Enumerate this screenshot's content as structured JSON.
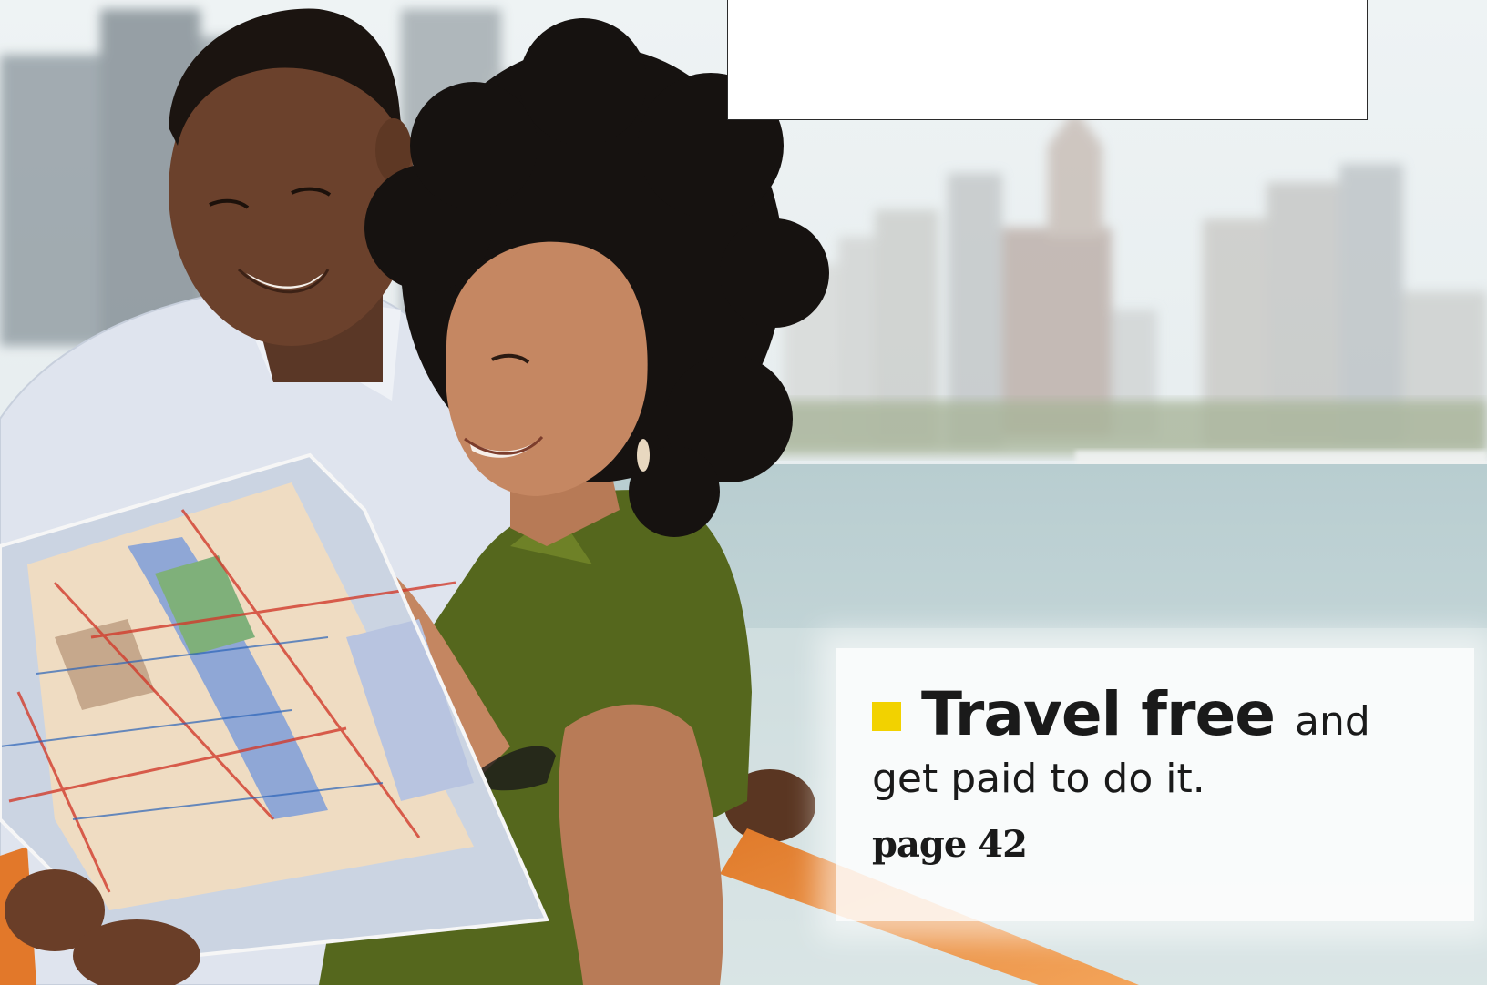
{
  "promo": {
    "headline_bold": "Travel free",
    "headline_rest": "and",
    "headline_line2": "get paid to do it.",
    "page_reference": "page 42"
  },
  "colors": {
    "bullet": "#f2d200",
    "text": "#1a1a1a"
  },
  "photo": {
    "subject": "couple-reading-city-map-on-ferry"
  }
}
